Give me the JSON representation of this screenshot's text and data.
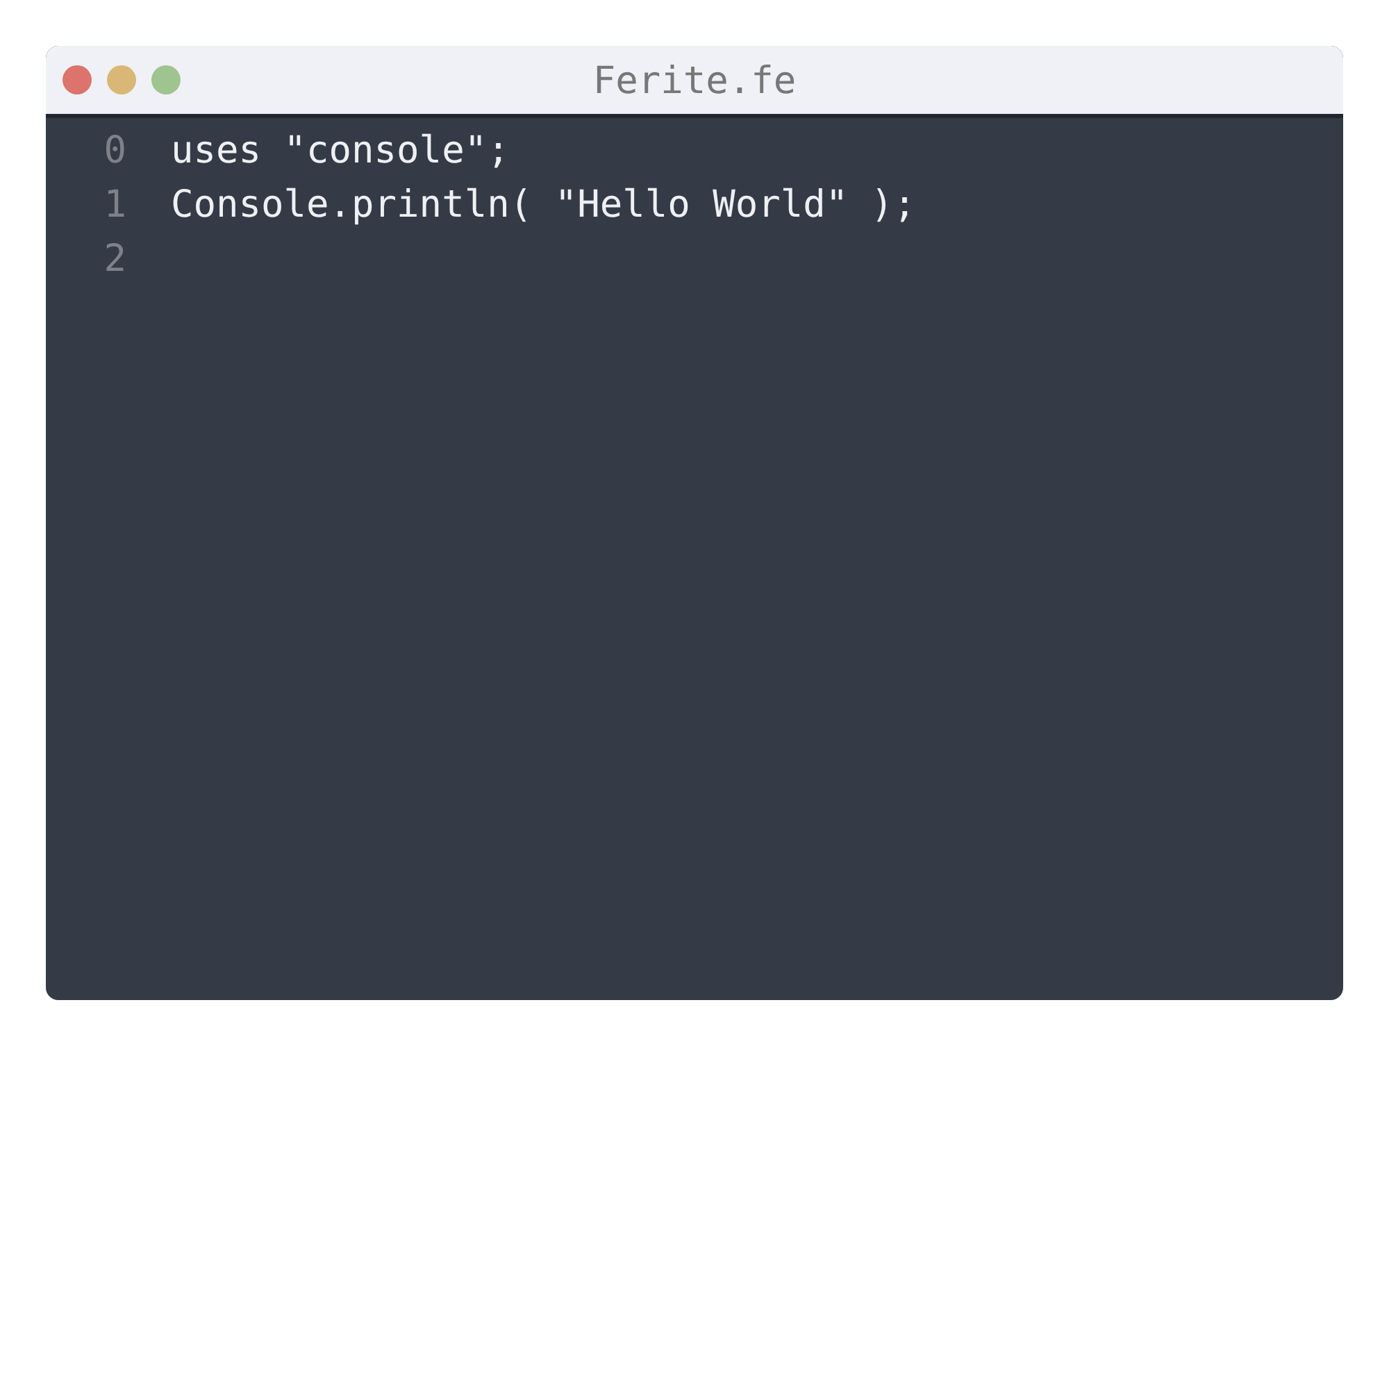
{
  "window": {
    "title": "Ferite.fe",
    "buttons": [
      {
        "kind": "close"
      },
      {
        "kind": "minimize"
      },
      {
        "kind": "maximize"
      }
    ]
  },
  "editor": {
    "lines": [
      {
        "number": "0",
        "code": "uses \"console\";"
      },
      {
        "number": "1",
        "code": "Console.println( \"Hello World\" );"
      },
      {
        "number": "2"
      }
    ]
  }
}
